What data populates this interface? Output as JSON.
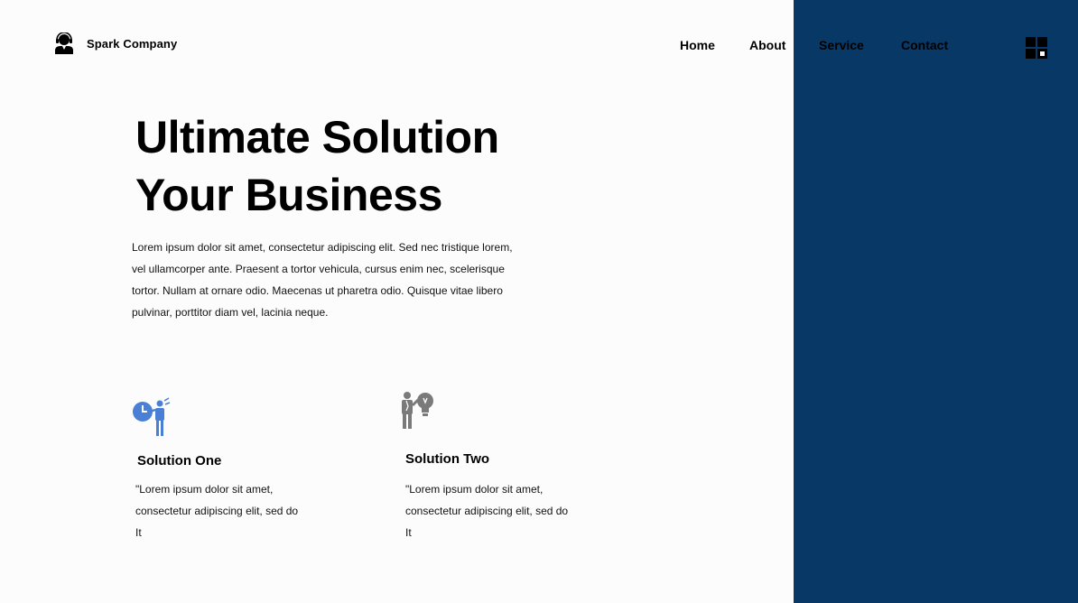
{
  "brand": {
    "name": "Spark Company",
    "icon": "person-with-headset-icon"
  },
  "nav": {
    "items": [
      "Home",
      "About",
      "Service",
      "Contact"
    ],
    "menu_icon": "grid-menu-icon"
  },
  "hero": {
    "title_line1": "Ultimate Solution",
    "title_line2": "Your Business",
    "text": "Lorem ipsum dolor sit amet, consectetur adipiscing elit. Sed nec tristique lorem, vel ullamcorper ante. Praesent a tortor vehicula, cursus enim nec, scelerisque tortor. Nullam at ornare odio. Maecenas ut pharetra odio. Quisque vitae libero pulvinar, porttitor diam vel, lacinia neque."
  },
  "features": [
    {
      "icon": "clock-person-icon",
      "title": "Solution One",
      "text": "\"Lorem ipsum dolor sit amet, consectetur adipiscing elit, sed do It"
    },
    {
      "icon": "person-lightbulb-icon",
      "title": "Solution Two",
      "text": "\"Lorem ipsum dolor sit amet, consectetur adipiscing elit, sed do It"
    }
  ],
  "colors": {
    "side_panel": "#083866",
    "background": "#fdfcfd",
    "icon_blue": "#4a7fd6",
    "icon_gray": "#7a7a7a"
  }
}
